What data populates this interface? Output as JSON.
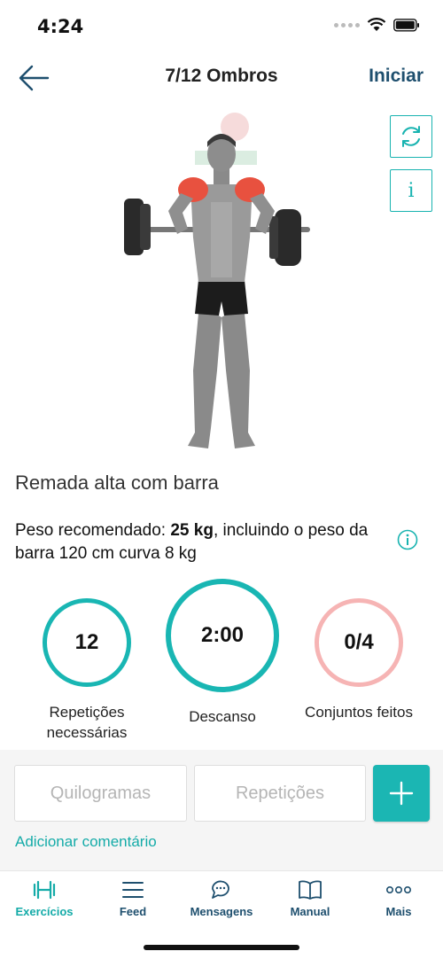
{
  "status": {
    "time": "4:24"
  },
  "header": {
    "title": "7/12 Ombros",
    "start_label": "Iniciar"
  },
  "exercise": {
    "name": "Remada alta com barra",
    "weight_prefix": "Peso recomendado: ",
    "weight_value": "25 kg",
    "weight_suffix": ", incluindo o peso da barra 120 cm curva 8 kg"
  },
  "stats": {
    "reps_value": "12",
    "reps_label": "Repetições necessárias",
    "rest_value": "2:00",
    "rest_label": "Descanso",
    "sets_value": "0/4",
    "sets_label": "Conjuntos feitos"
  },
  "inputs": {
    "kg_placeholder": "Quilogramas",
    "reps_placeholder": "Repetições",
    "add_comment": "Adicionar comentário"
  },
  "tabs": [
    {
      "label": "Exercícios",
      "icon": "dumbbell-icon",
      "active": true
    },
    {
      "label": "Feed",
      "icon": "feed-icon",
      "active": false
    },
    {
      "label": "Mensagens",
      "icon": "chat-icon",
      "active": false
    },
    {
      "label": "Manual",
      "icon": "book-icon",
      "active": false
    },
    {
      "label": "Mais",
      "icon": "more-icon",
      "active": false
    }
  ],
  "colors": {
    "accent": "#19b6b3",
    "navy": "#1e4f6e",
    "sets_ring": "#f6b4b4",
    "muscle_highlight": "#e8513f"
  }
}
